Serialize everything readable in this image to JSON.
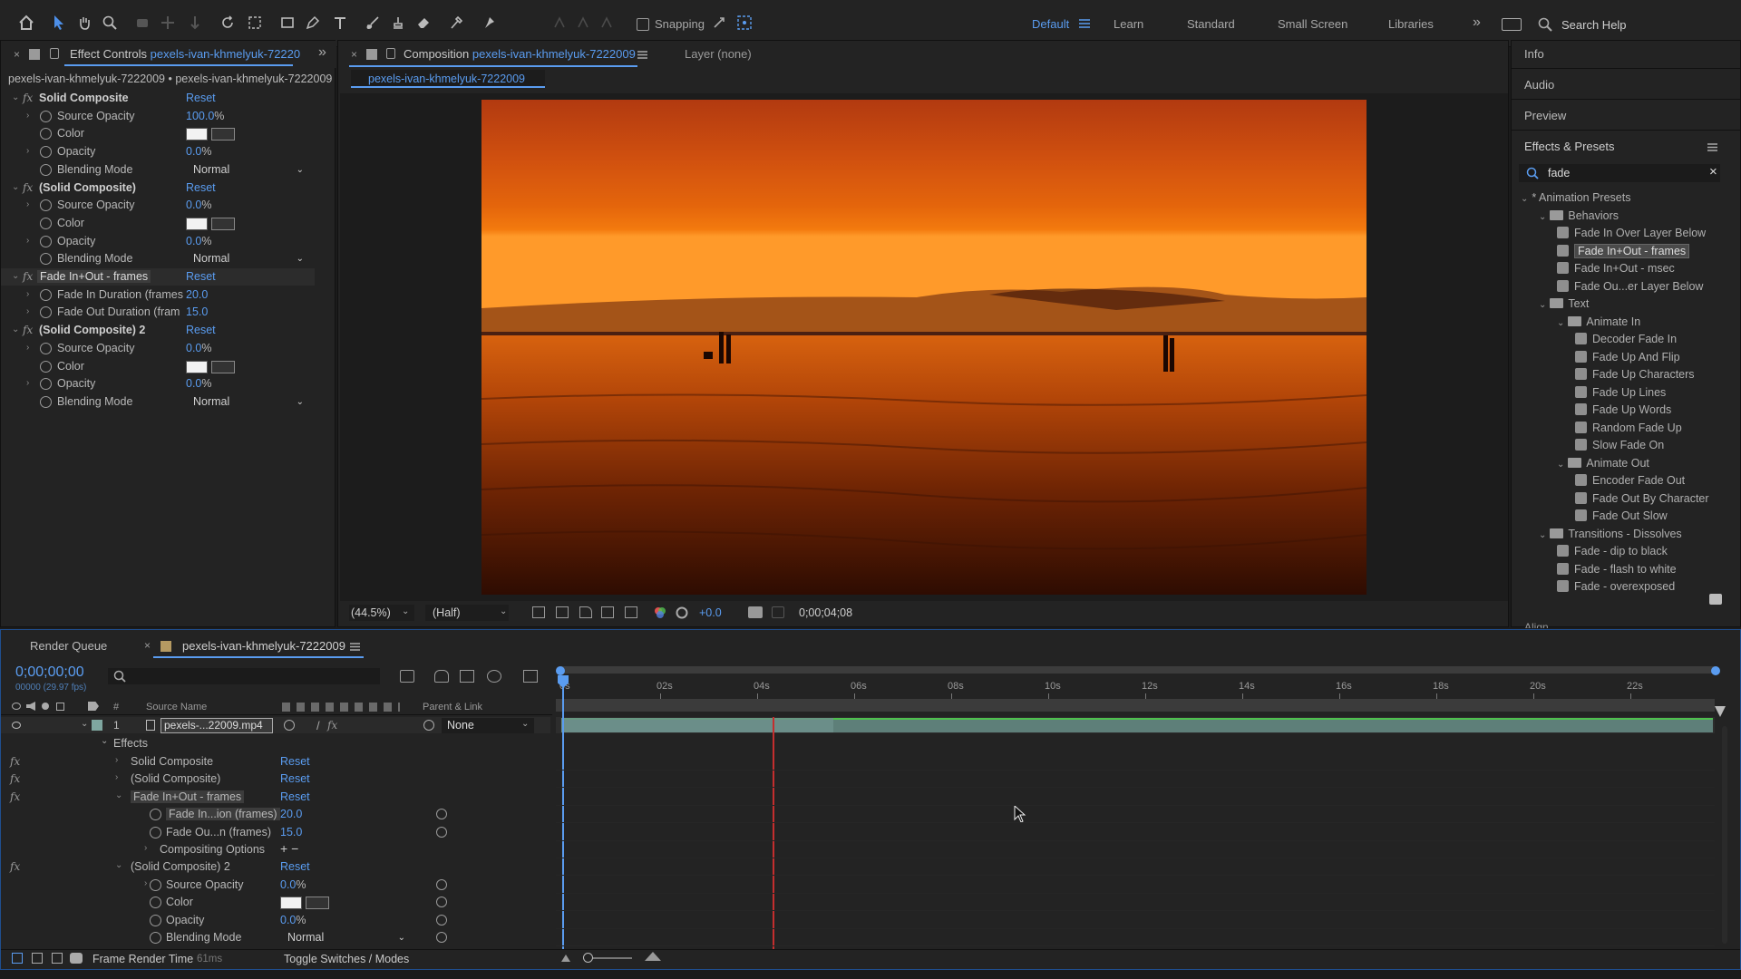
{
  "toolbar": {
    "snapping_label": "Snapping",
    "workspaces": [
      "Default",
      "Learn",
      "Standard",
      "Small Screen",
      "Libraries"
    ],
    "search_help": "Search Help"
  },
  "effect_controls": {
    "tab_title": "Effect Controls",
    "tab_source": "pexels-ivan-khmelyuk-72220",
    "breadcrumb": "pexels-ivan-khmelyuk-7222009 • pexels-ivan-khmelyuk-7222009",
    "rows": [
      {
        "type": "fx",
        "label": "Solid Composite",
        "reset": "Reset",
        "bold": true
      },
      {
        "type": "prop",
        "label": "Source Opacity",
        "value": "100.0",
        "unit": "%",
        "red": true,
        "chev": true
      },
      {
        "type": "color",
        "label": "Color"
      },
      {
        "type": "prop",
        "label": "Opacity",
        "value": "0.0",
        "unit": "%",
        "chev": true
      },
      {
        "type": "dd",
        "label": "Blending Mode",
        "value": "Normal"
      },
      {
        "type": "fx",
        "label": "(Solid Composite)",
        "reset": "Reset",
        "bold": true
      },
      {
        "type": "prop",
        "label": "Source Opacity",
        "value": "0.0",
        "unit": "%",
        "red": true,
        "chev": true
      },
      {
        "type": "color",
        "label": "Color"
      },
      {
        "type": "prop",
        "label": "Opacity",
        "value": "0.0",
        "unit": "%",
        "chev": true
      },
      {
        "type": "dd",
        "label": "Blending Mode",
        "value": "Normal"
      },
      {
        "type": "fx",
        "label": "Fade In+Out - frames",
        "reset": "Reset",
        "bold": false,
        "boxed": true
      },
      {
        "type": "prop",
        "label": "Fade In Duration (frames",
        "value": "20.0",
        "unit": "",
        "chev": true
      },
      {
        "type": "prop",
        "label": "Fade Out Duration (fram",
        "value": "15.0",
        "unit": "",
        "chev": true
      },
      {
        "type": "fx",
        "label": "(Solid Composite) 2",
        "reset": "Reset",
        "bold": true
      },
      {
        "type": "prop",
        "label": "Source Opacity",
        "value": "0.0",
        "unit": "%",
        "red": true,
        "chev": true
      },
      {
        "type": "color",
        "label": "Color"
      },
      {
        "type": "prop",
        "label": "Opacity",
        "value": "0.0",
        "unit": "%",
        "chev": true
      },
      {
        "type": "dd",
        "label": "Blending Mode",
        "value": "Normal"
      }
    ]
  },
  "composition": {
    "tab_title": "Composition",
    "tab_source": "pexels-ivan-khmelyuk-7222009",
    "layer_tab": "Layer (none)",
    "subtab": "pexels-ivan-khmelyuk-7222009",
    "zoom": "(44.5%)",
    "resolution": "(Half)",
    "exposure": "+0.0",
    "timecode": "0;00;04;08"
  },
  "right_panel": {
    "items": [
      "Info",
      "Audio",
      "Preview"
    ],
    "effects_title": "Effects & Presets",
    "search_value": "fade",
    "tree": [
      {
        "label": "* Animation Presets",
        "level": 0,
        "kind": "root"
      },
      {
        "label": "Behaviors",
        "level": 1,
        "kind": "folder"
      },
      {
        "label": "Fade In Over Layer Below",
        "level": 2,
        "kind": "preset"
      },
      {
        "label": "Fade In+Out - frames",
        "level": 2,
        "kind": "preset",
        "selected": true
      },
      {
        "label": "Fade In+Out - msec",
        "level": 2,
        "kind": "preset"
      },
      {
        "label": "Fade Ou...er Layer Below",
        "level": 2,
        "kind": "preset"
      },
      {
        "label": "Text",
        "level": 1,
        "kind": "folder"
      },
      {
        "label": "Animate In",
        "level": 2,
        "kind": "folder"
      },
      {
        "label": "Decoder Fade In",
        "level": 3,
        "kind": "preset"
      },
      {
        "label": "Fade Up And Flip",
        "level": 3,
        "kind": "preset"
      },
      {
        "label": "Fade Up Characters",
        "level": 3,
        "kind": "preset"
      },
      {
        "label": "Fade Up Lines",
        "level": 3,
        "kind": "preset"
      },
      {
        "label": "Fade Up Words",
        "level": 3,
        "kind": "preset"
      },
      {
        "label": "Random Fade Up",
        "level": 3,
        "kind": "preset"
      },
      {
        "label": "Slow Fade On",
        "level": 3,
        "kind": "preset"
      },
      {
        "label": "Animate Out",
        "level": 2,
        "kind": "folder"
      },
      {
        "label": "Encoder Fade Out",
        "level": 3,
        "kind": "preset"
      },
      {
        "label": "Fade Out By Character",
        "level": 3,
        "kind": "preset"
      },
      {
        "label": "Fade Out Slow",
        "level": 3,
        "kind": "preset"
      },
      {
        "label": "Transitions - Dissolves",
        "level": 1,
        "kind": "folder"
      },
      {
        "label": "Fade - dip to black",
        "level": 2,
        "kind": "preset"
      },
      {
        "label": "Fade - flash to white",
        "level": 2,
        "kind": "preset"
      },
      {
        "label": "Fade - overexposed",
        "level": 2,
        "kind": "preset"
      }
    ],
    "align_label": "Align"
  },
  "timeline": {
    "render_queue_tab": "Render Queue",
    "comp_tab": "pexels-ivan-khmelyuk-7222009",
    "timecode": "0;00;00;00",
    "frame_info": "00000 (29.97 fps)",
    "col_number": "#",
    "col_source": "Source Name",
    "col_parent": "Parent & Link",
    "layer_num": "1",
    "layer_name": "pexels-...22009.mp4",
    "parent_value": "None",
    "effects_label": "Effects",
    "rows": [
      {
        "label": "Solid Composite",
        "indent": 1,
        "fx": true,
        "chev": "›",
        "reset": "Reset"
      },
      {
        "label": "(Solid Composite)",
        "indent": 1,
        "fx": true,
        "chev": "›",
        "reset": "Reset"
      },
      {
        "label": "Fade In+Out - frames",
        "indent": 1,
        "fx": true,
        "chev": "⌄",
        "reset": "Reset",
        "boxed": true
      },
      {
        "label": "Fade In...ion (frames)",
        "indent": 2,
        "stop": true,
        "value": "20.0",
        "boxed": true,
        "link": true
      },
      {
        "label": "Fade Ou...n (frames)",
        "indent": 2,
        "stop": true,
        "value": "15.0",
        "link": true
      },
      {
        "label": "Compositing Options",
        "indent": 2,
        "chev": "›",
        "plusminus": true
      },
      {
        "label": "(Solid Composite) 2",
        "indent": 1,
        "fx": true,
        "chev": "⌄",
        "reset": "Reset"
      },
      {
        "label": "Source Opacity",
        "indent": 2,
        "stop": true,
        "chev": "›",
        "value": "0.0",
        "unit": "%",
        "red": true,
        "link": true
      },
      {
        "label": "Color",
        "indent": 2,
        "stop": true,
        "color": true,
        "link": true
      },
      {
        "label": "Opacity",
        "indent": 2,
        "stop": true,
        "value": "0.0",
        "unit": "%",
        "link": true
      },
      {
        "label": "Blending Mode",
        "indent": 2,
        "stop": true,
        "dd": "Normal",
        "link": true
      }
    ],
    "ruler": [
      "0s",
      "02s",
      "04s",
      "06s",
      "08s",
      "10s",
      "12s",
      "14s",
      "16s",
      "18s",
      "20s",
      "22s"
    ],
    "bottom_frame_render": "Frame Render Time",
    "bottom_frame_ms": "61ms",
    "bottom_toggle": "Toggle Switches / Modes"
  },
  "colors": {
    "accent": "#5a9cf0",
    "playhead": "#e03c3c",
    "panel_bg": "#232323"
  }
}
